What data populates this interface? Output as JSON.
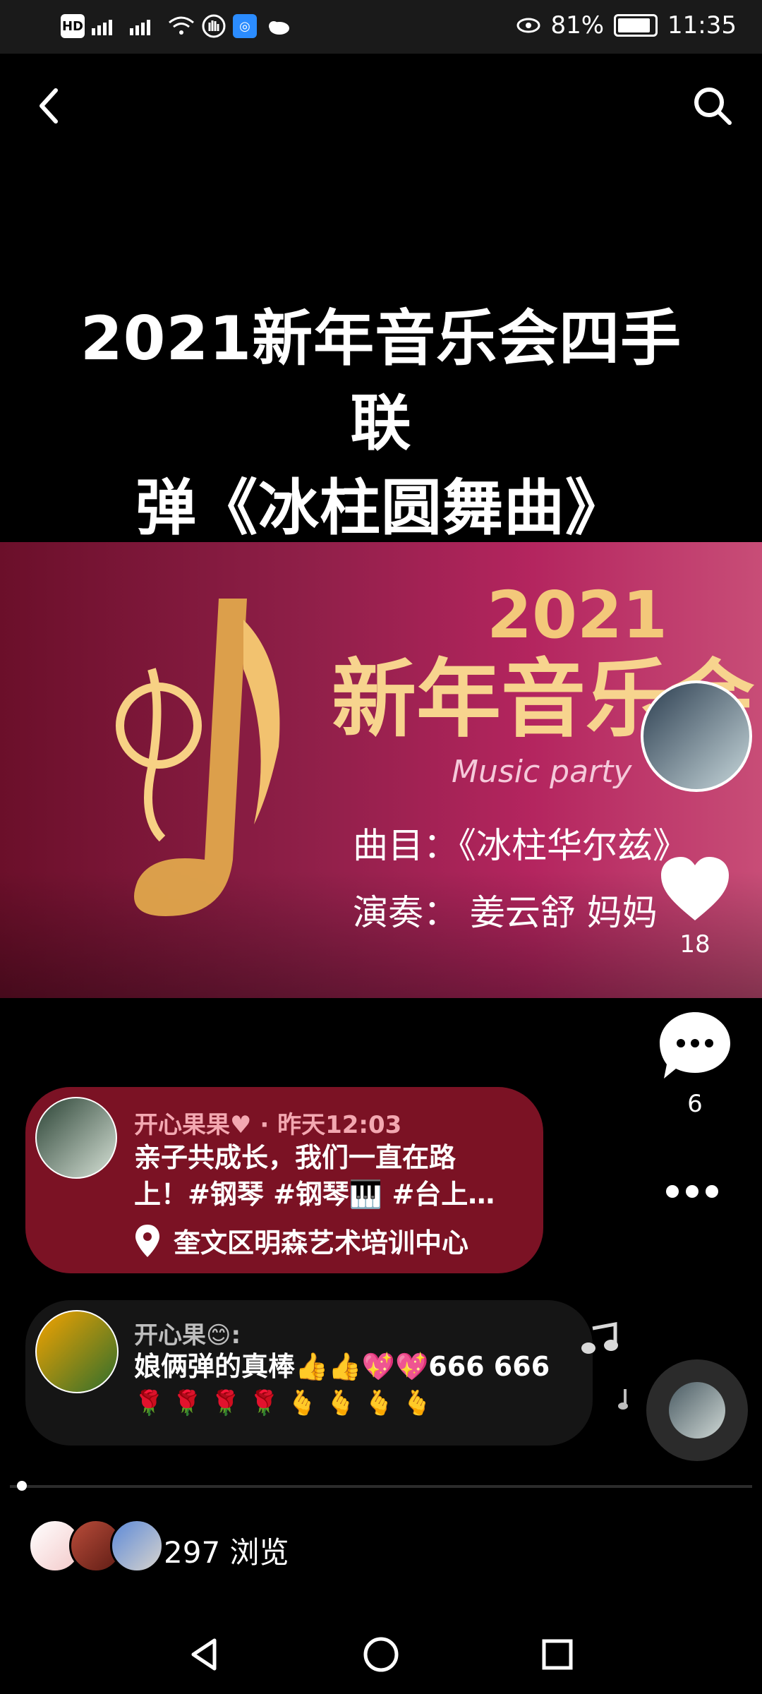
{
  "status_bar": {
    "time": "11:35",
    "battery": "81%",
    "battery_level": 0.81,
    "left_icons": [
      "hd-icon",
      "signal-4g-icon",
      "signal-4g-icon",
      "wifi-icon",
      "hand-icon",
      "app-icon",
      "cloud-icon"
    ]
  },
  "header": {
    "back_icon": "chevron-left-icon",
    "search_icon": "search-icon"
  },
  "post": {
    "title_line1": "2021新年音乐会四手联",
    "title_line2": "弹《冰柱圆舞曲》",
    "banner": {
      "year": "2021",
      "title": "新年音乐会",
      "subtitle": "Music party",
      "song": "曲目：《冰柱华尔兹》",
      "players": "演奏：  姜云舒  妈妈"
    },
    "likes": "18",
    "comments": "6",
    "author": "开心果果♥",
    "time": "· 昨天12:03",
    "text": "亲子共成长，我们一直在路上！#钢琴 #钢琴🎹 #台上…",
    "location": "奎文区明森艺术培训中心"
  },
  "comment": {
    "name": "开心果😊:",
    "text": "娘俩弹的真棒👍👍💖💖666 666",
    "emoji_row": "🌹🌹🌹🌹🫰🫰🫰🫰"
  },
  "footer": {
    "views": "297 浏览"
  },
  "nav": {
    "back": "nav-back-icon",
    "home": "nav-home-icon",
    "recent": "nav-recent-icon"
  },
  "colors": {
    "accent_card": "#7b1224",
    "comment_card": "#151515",
    "background": "#000000"
  }
}
